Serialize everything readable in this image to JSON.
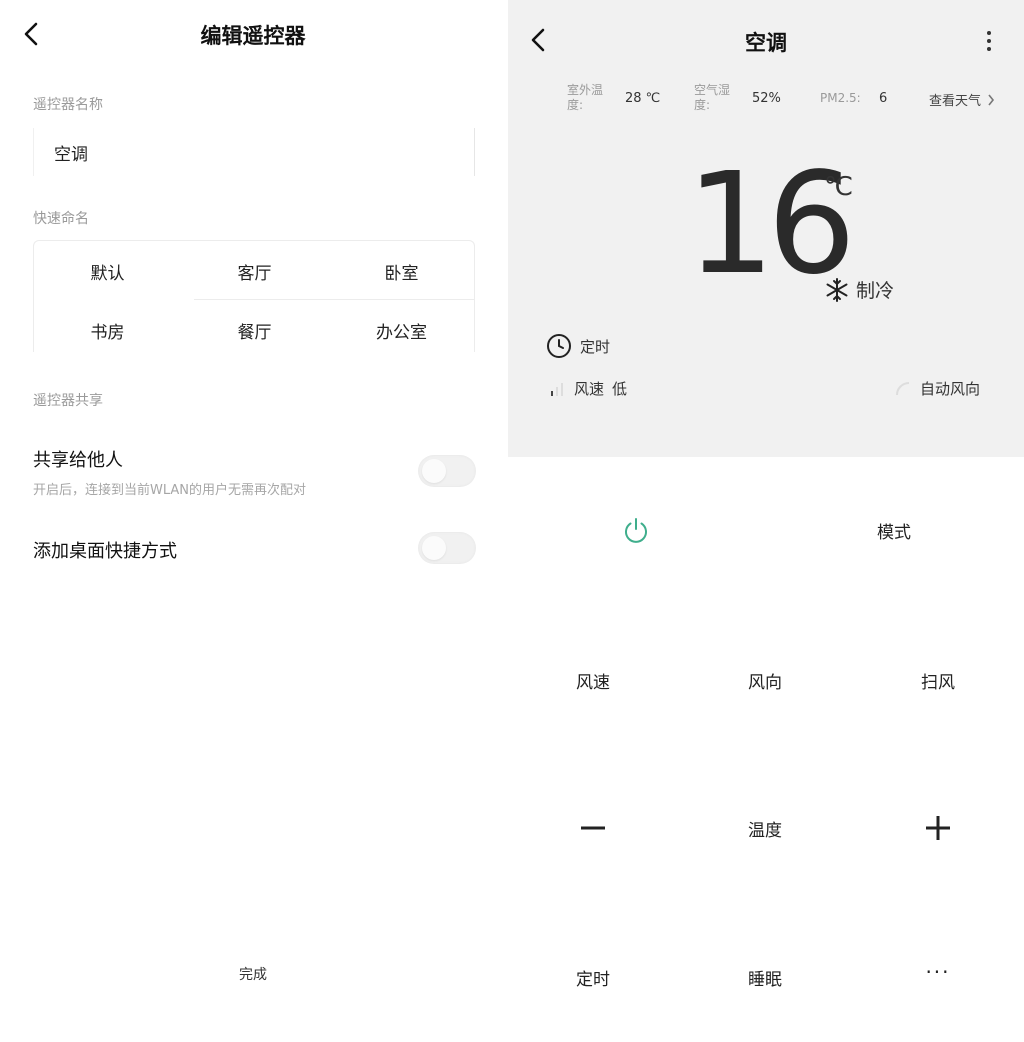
{
  "editor": {
    "title": "编辑遥控器",
    "name_section": "遥控器名称",
    "name_value": "空调",
    "quick_section": "快速命名",
    "quick_names": [
      "默认",
      "客厅",
      "卧室",
      "书房",
      "餐厅",
      "办公室"
    ],
    "share_section": "遥控器共享",
    "share_title": "共享给他人",
    "share_desc": "开启后，连接到当前WLAN的用户无需再次配对",
    "share_on": false,
    "shortcut_title": "添加桌面快捷方式",
    "shortcut_on": false,
    "done_label": "完成"
  },
  "remote": {
    "title": "空调",
    "env": {
      "outdoor_label": "室外温度:",
      "outdoor_value": "28 ℃",
      "humidity_label": "空气湿度:",
      "humidity_value": "52%",
      "pm_label": "PM2.5:",
      "pm_value": "6",
      "weather_link": "查看天气"
    },
    "temperature": "16",
    "unit": "℃",
    "mode": "制冷",
    "timer": "定时",
    "fan_label": "风速",
    "fan_value": "低",
    "swing": "自动风向",
    "controls": {
      "mode": "模式",
      "fan_speed": "风速",
      "fan_dir": "风向",
      "sweep": "扫风",
      "temp": "温度",
      "timer": "定时",
      "sleep": "睡眠",
      "more": "···"
    },
    "accent": "#3fae8c"
  }
}
